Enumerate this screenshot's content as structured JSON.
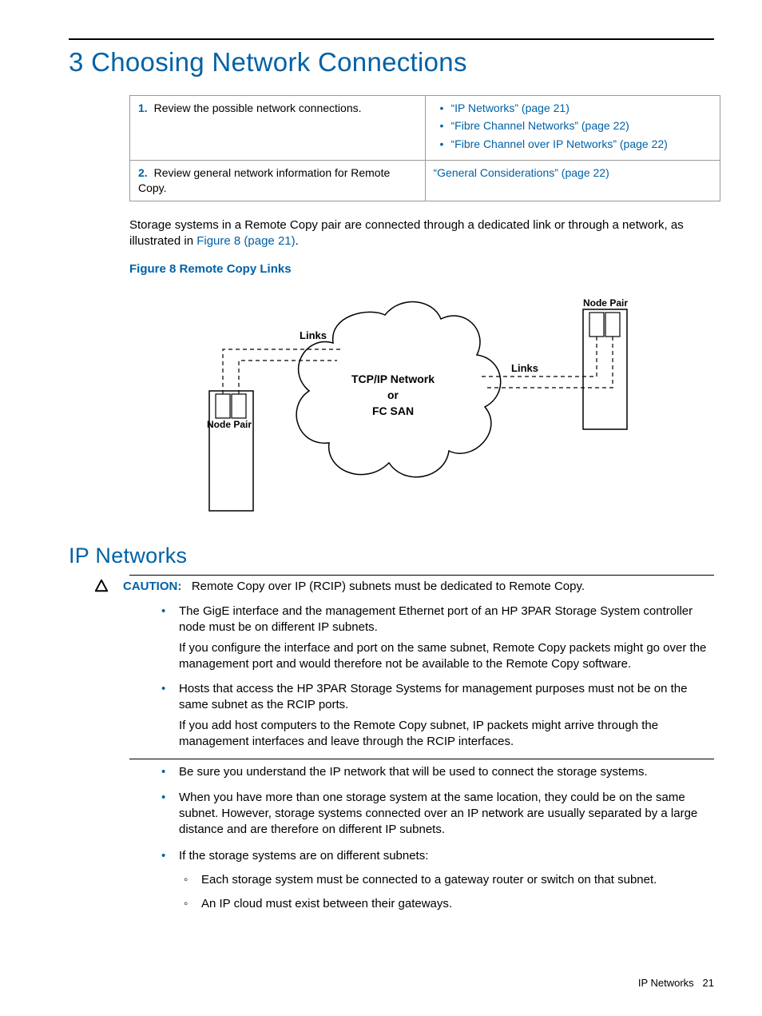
{
  "title": "3 Choosing Network Connections",
  "steps": [
    {
      "num": "1.",
      "text": "Review the possible network connections.",
      "refs": [
        "“IP Networks” (page 21)",
        "“Fibre Channel Networks” (page 22)",
        "“Fibre Channel over IP Networks” (page 22)"
      ]
    },
    {
      "num": "2.",
      "text": "Review general network information for Remote Copy.",
      "refs_single": "“General Considerations” (page 22)"
    }
  ],
  "para1_a": "Storage systems in a Remote Copy pair are connected through a dedicated link or through a network, as illustrated in ",
  "para1_link": "Figure 8 (page 21)",
  "para1_b": ".",
  "fig_caption": "Figure 8 Remote Copy Links",
  "fig": {
    "links1": "Links",
    "links2": "Links",
    "cloud1": "TCP/IP Network",
    "cloud2": "or",
    "cloud3": "FC SAN",
    "np1": "Node Pair",
    "np2": "Node Pair"
  },
  "section2": "IP Networks",
  "caution_label": "CAUTION:",
  "caution_text": "Remote Copy over IP (RCIP) subnets must be dedicated to Remote Copy.",
  "caution_items": [
    {
      "p1": "The GigE interface and the management Ethernet port of an HP 3PAR Storage System controller node must be on different IP subnets.",
      "p2": "If you configure the interface and port on the same subnet, Remote Copy packets might go over the management port and would therefore not be available to the Remote Copy software."
    },
    {
      "p1": "Hosts that access the HP 3PAR Storage Systems for management purposes must not be on the same subnet as the RCIP ports.",
      "p2": "If you add host computers to the Remote Copy subnet, IP packets might arrive through the management interfaces and leave through the RCIP interfaces."
    }
  ],
  "plain_items": [
    "Be sure you understand the IP network that will be used to connect the storage systems.",
    "When you have more than one storage system at the same location, they could be on the same subnet. However, storage systems connected over an IP network are usually separated by a large distance and are therefore on different IP subnets.",
    "If the storage systems are on different subnets:"
  ],
  "sub_items": [
    "Each storage system must be connected to a gateway router or switch on that subnet.",
    "An IP cloud must exist between their gateways."
  ],
  "footer_label": "IP Networks",
  "footer_page": "21"
}
